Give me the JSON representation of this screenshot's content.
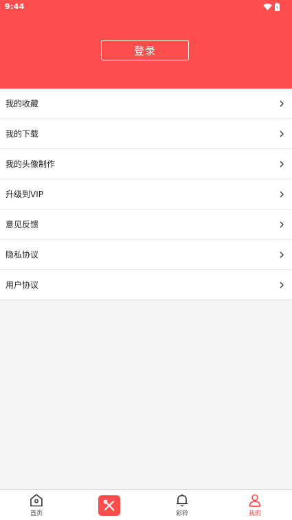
{
  "status_bar": {
    "time": "9:44",
    "icons": [
      "wifi-icon",
      "battery-icon"
    ]
  },
  "header": {
    "login_label": "登录"
  },
  "menu": {
    "items": [
      {
        "label": "我的收藏",
        "icon": "chevron-right-icon"
      },
      {
        "label": "我的下载",
        "icon": "chevron-right-icon"
      },
      {
        "label": "我的头像制作",
        "icon": "chevron-right-icon"
      },
      {
        "label": "升级到VIP",
        "icon": "chevron-right-icon"
      },
      {
        "label": "意见反馈",
        "icon": "chevron-right-icon"
      },
      {
        "label": "隐私协议",
        "icon": "chevron-right-icon"
      },
      {
        "label": "用户协议",
        "icon": "chevron-right-icon"
      }
    ]
  },
  "tabbar": {
    "tabs": [
      {
        "label": "首页",
        "icon": "home-icon",
        "active": false
      },
      {
        "label": "",
        "icon": "tools-icon",
        "active": false
      },
      {
        "label": "彩铃",
        "icon": "bell-icon",
        "active": false
      },
      {
        "label": "我的",
        "icon": "user-icon",
        "active": true
      }
    ]
  },
  "colors": {
    "accent": "#fe4d4d",
    "background": "#f4f4f4",
    "divider": "#e4e4e4"
  }
}
